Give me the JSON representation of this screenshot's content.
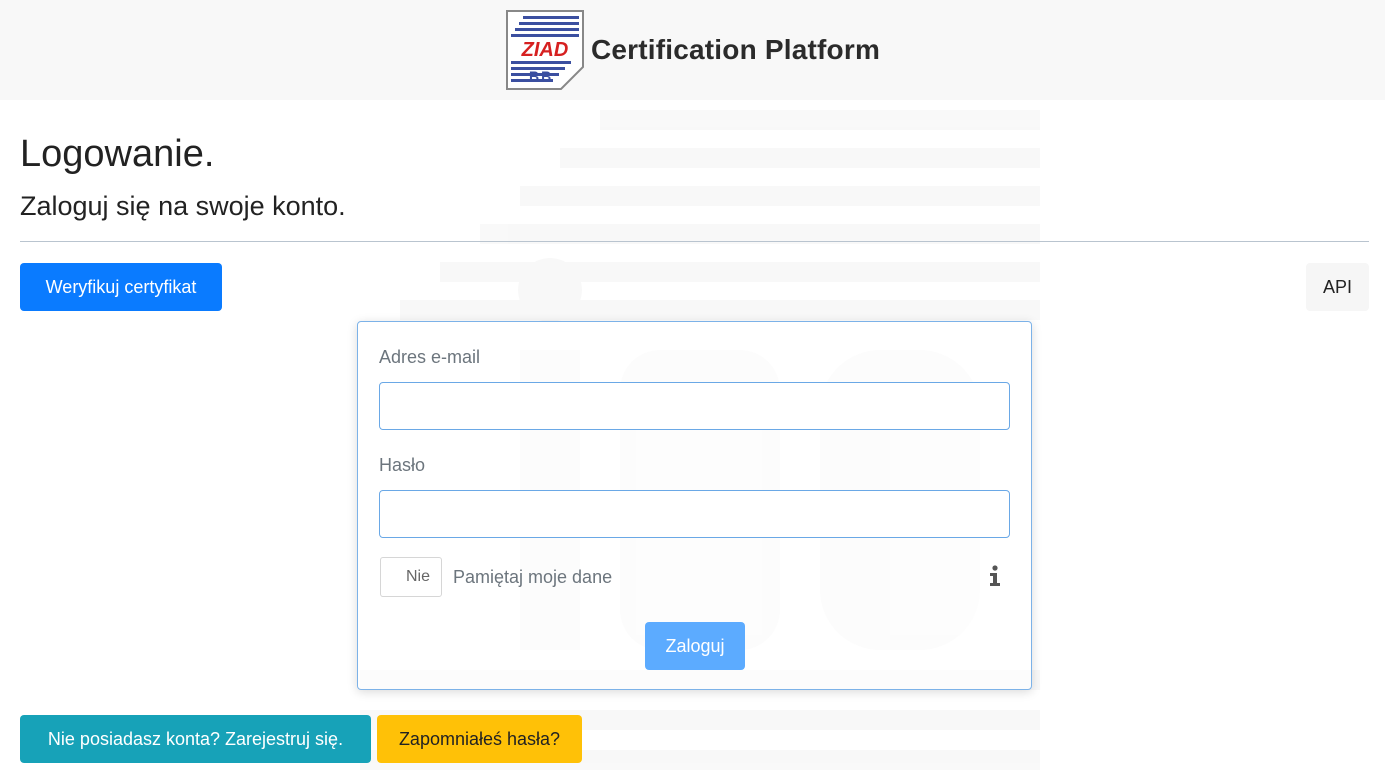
{
  "header": {
    "brand": "Certification Platform",
    "logo_text": "ZIAD BB"
  },
  "page": {
    "title": "Logowanie.",
    "subtitle": "Zaloguj się na swoje konto."
  },
  "toolbar": {
    "verify_label": "Weryfikuj certyfikat",
    "api_label": "API"
  },
  "form": {
    "email_label": "Adres e-mail",
    "email_value": "",
    "password_label": "Hasło",
    "password_value": "",
    "remember_toggle": "Nie",
    "remember_label": "Pamiętaj moje dane",
    "login_label": "Zaloguj"
  },
  "footer": {
    "register_label": "Nie posiadasz konta? Zarejestruj się.",
    "forgot_label": "Zapomniałeś hasła?"
  },
  "colors": {
    "primary": "#0a7bff",
    "info": "#17a2b8",
    "warning": "#ffc107",
    "login_disabled": "#5cabff"
  }
}
